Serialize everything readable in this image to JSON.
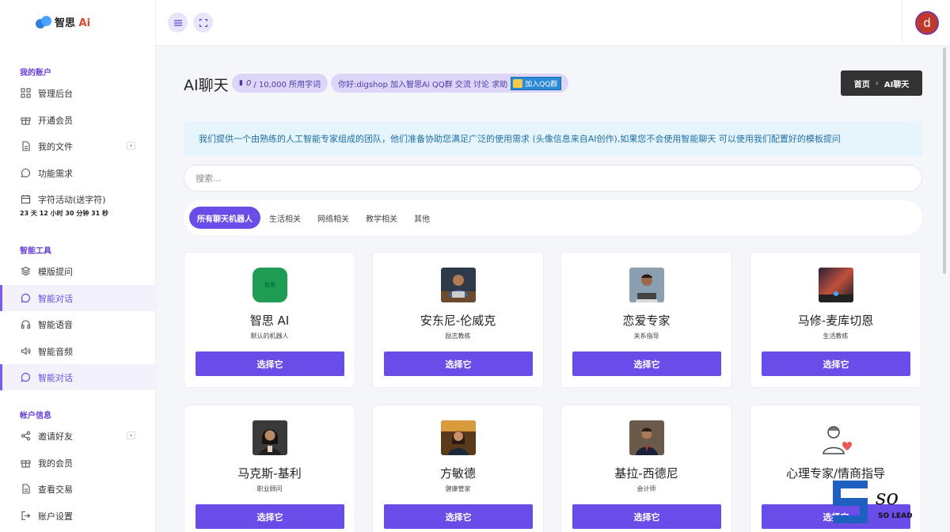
{
  "brand": {
    "name": "智思",
    "suffix": "Ai"
  },
  "sidebar": {
    "sections": [
      {
        "title": "我的账户"
      },
      {
        "title": "智能工具"
      },
      {
        "title": "帐户信息"
      }
    ],
    "items": [
      {
        "label": "管理后台",
        "icon": "grid-icon"
      },
      {
        "label": "开通会员",
        "icon": "gift-icon"
      },
      {
        "label": "我的文件",
        "icon": "file-icon"
      },
      {
        "label": "功能需求",
        "icon": "chat-icon"
      },
      {
        "label": "字符活动(送字符)",
        "icon": "calendar-icon"
      },
      {
        "label": "模版提问",
        "icon": "layers-icon"
      },
      {
        "label": "智能对话",
        "icon": "chat-icon"
      },
      {
        "label": "智能语音",
        "icon": "headphones-icon"
      },
      {
        "label": "智能音频",
        "icon": "speaker-icon"
      },
      {
        "label": "智能对话",
        "icon": "chat-icon"
      },
      {
        "label": "邀请好友",
        "icon": "share-icon"
      },
      {
        "label": "我的会员",
        "icon": "gift-icon"
      },
      {
        "label": "查看交易",
        "icon": "document-icon"
      },
      {
        "label": "账户设置",
        "icon": "logout-icon"
      }
    ],
    "countdown": "23 天 12 小时 30 分钟 31 秒"
  },
  "topbar": {
    "avatar_letter": "d"
  },
  "page": {
    "title": "AI聊天",
    "usage_count": "0",
    "usage_total": "/ 10,000 所用字词",
    "qq_text": "你好:digshop 加入智思Ai QQ群 交流 讨论 求助",
    "qq_button": "加入QQ群"
  },
  "breadcrumb": {
    "home": "首页",
    "current": "AI聊天"
  },
  "notice": "我们提供一个由熟练的人工智能专家组成的团队，他们准备协助您满足广泛的使用需求 (头像信息来自AI创作),如果您不会使用智能聊天 可以使用我们配置好的模板提问",
  "search": {
    "placeholder": "搜索..."
  },
  "tabs": [
    "所有聊天机器人",
    "生活相关",
    "网络相关",
    "教学相关",
    "其他"
  ],
  "select_label": "选择它",
  "bots": [
    {
      "name": "智思 AI",
      "role": "默认的机器人",
      "avatar_text": "智思",
      "avatar_color": "#1f9d55"
    },
    {
      "name": "安东尼-伦威克",
      "role": "励志教练",
      "avatar_color": "#5b4a3a"
    },
    {
      "name": "恋爱专家",
      "role": "关系指导",
      "avatar_color": "#4a5b6a"
    },
    {
      "name": "马修-麦库切恩",
      "role": "生活教练",
      "avatar_color": "#3b2f4a"
    },
    {
      "name": "马克斯-基利",
      "role": "职业顾问",
      "avatar_color": "#3a3a3a"
    },
    {
      "name": "方敏德",
      "role": "健康管家",
      "avatar_color": "#4a3a22"
    },
    {
      "name": "基拉-西德尼",
      "role": "会计师",
      "avatar_color": "#5a4a3a"
    },
    {
      "name": "心理专家/情商指导",
      "role": "",
      "avatar_color": "#ffffff"
    }
  ],
  "watermark": {
    "text": "SO LEAD"
  }
}
